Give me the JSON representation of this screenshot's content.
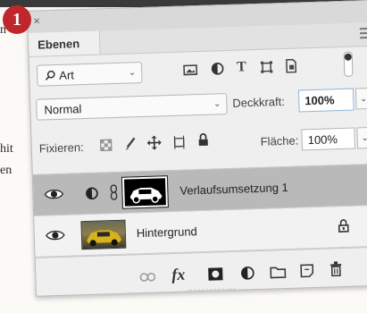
{
  "page": {
    "badge_number": "1",
    "margin_text": [
      "n",
      "hit",
      "en"
    ]
  },
  "panel": {
    "tab_label": "Ebenen",
    "close_glyph": "×",
    "collapse_glyph": "‹‹",
    "filter_select": "Art",
    "filter_icons": [
      "image-filter-icon",
      "adjustment-filter-icon",
      "type-filter-icon",
      "shape-filter-icon",
      "smartobject-filter-icon"
    ],
    "blend_mode": "Normal",
    "opacity_label": "Deckkraft:",
    "opacity_value": "100%",
    "lock_label": "Fixieren:",
    "lock_icons": [
      "lock-transparent-icon",
      "lock-image-icon",
      "lock-position-icon",
      "lock-artboard-icon",
      "lock-all-icon"
    ],
    "fill_label": "Fläche:",
    "fill_value": "100%",
    "layers": [
      {
        "name": "Verlaufsumsetzung 1",
        "selected": true
      },
      {
        "name": "Hintergrund",
        "selected": false
      }
    ],
    "bottom_icons": [
      "link-icon",
      "fx-icon",
      "mask-icon",
      "adjustment-icon",
      "folder-icon",
      "new-layer-icon",
      "trash-icon"
    ],
    "fx_text": "fx",
    "accent_color": "#4a90d9"
  }
}
